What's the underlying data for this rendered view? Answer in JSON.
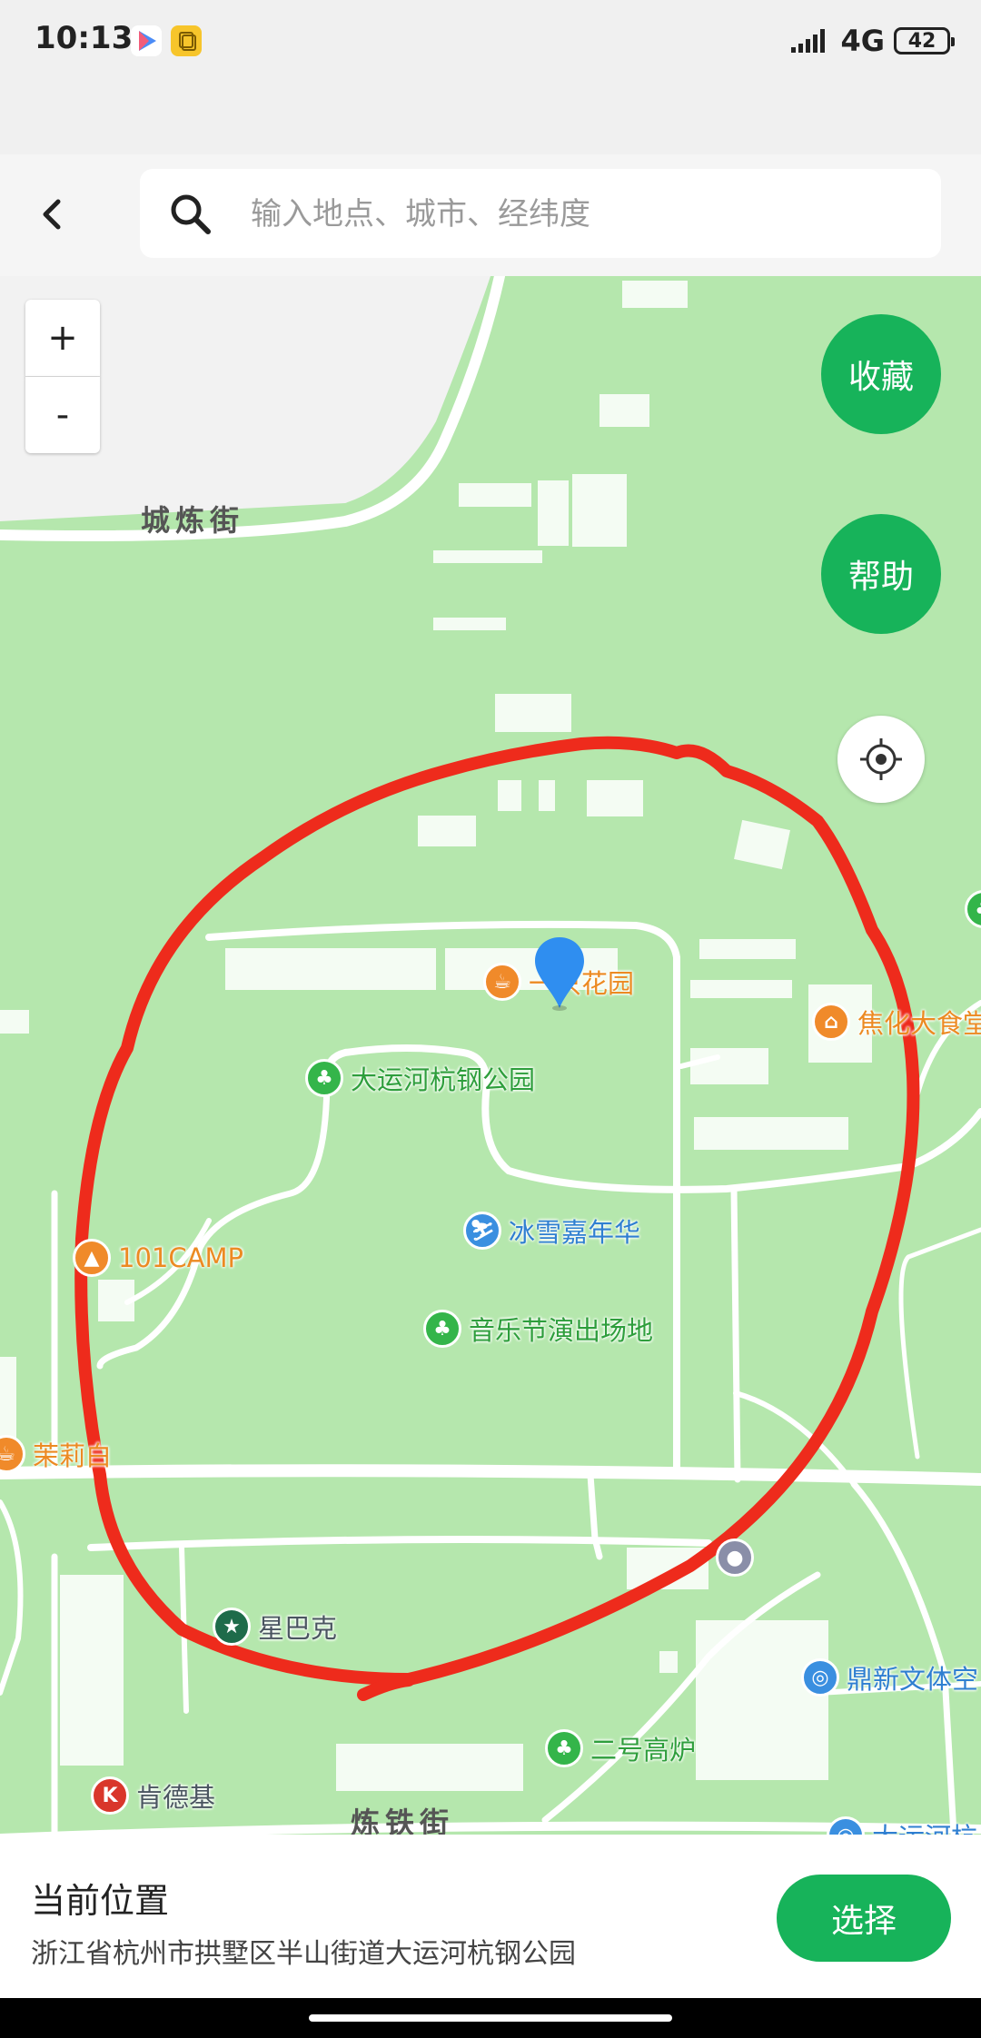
{
  "status_bar": {
    "time": "10:13",
    "network": "4G",
    "battery": "42"
  },
  "search": {
    "placeholder": "输入地点、城市、经纬度",
    "value": ""
  },
  "map_controls": {
    "zoom_in": "+",
    "zoom_out": "-",
    "favorite": "收藏",
    "help": "帮助"
  },
  "streets": {
    "north": "城炼街",
    "south": "炼铁街"
  },
  "pois": {
    "garden": "一只花园",
    "park": "大运河杭钢公园",
    "food_court": "焦化大食堂",
    "ice_snow": "冰雪嘉年华",
    "camp": "101CAMP",
    "music_venue": "音乐节演出场地",
    "jasmine": "茉莉白",
    "starbucks": "星巴克",
    "sports": "鼎新文体空",
    "furnace": "二号高炉",
    "kfc": "肯德基",
    "canal_partial": "大运河杭"
  },
  "bottom_panel": {
    "title": "当前位置",
    "address": "浙江省杭州市拱墅区半山街道大运河杭钢公园",
    "select_button": "选择"
  },
  "colors": {
    "map_green": "#b5e7ad",
    "map_gray": "#f2f2f2",
    "accent_green": "#17b35a",
    "annotation_red": "#ee2b1c",
    "pin_blue": "#2f8ef0"
  }
}
